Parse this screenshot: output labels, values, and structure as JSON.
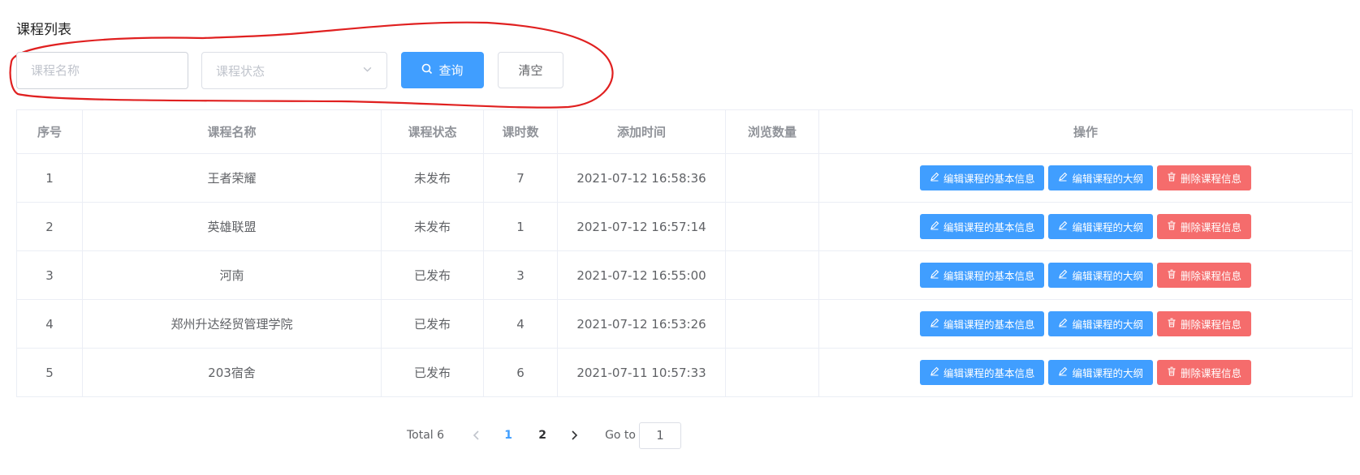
{
  "page": {
    "title": "课程列表"
  },
  "filters": {
    "name_placeholder": "课程名称",
    "status_placeholder": "课程状态",
    "query_label": "查询",
    "clear_label": "清空"
  },
  "colors": {
    "primary": "#409eff",
    "danger": "#f56c6c",
    "annotation": "#e02020"
  },
  "table": {
    "headers": [
      "序号",
      "课程名称",
      "课程状态",
      "课时数",
      "添加时间",
      "浏览数量",
      "操作"
    ],
    "rows": [
      {
        "index": "1",
        "name": "王者荣耀",
        "status": "未发布",
        "hours": "7",
        "time": "2021-07-12 16:58:36",
        "views": ""
      },
      {
        "index": "2",
        "name": "英雄联盟",
        "status": "未发布",
        "hours": "1",
        "time": "2021-07-12 16:57:14",
        "views": ""
      },
      {
        "index": "3",
        "name": "河南",
        "status": "已发布",
        "hours": "3",
        "time": "2021-07-12 16:55:00",
        "views": ""
      },
      {
        "index": "4",
        "name": "郑州升达经贸管理学院",
        "status": "已发布",
        "hours": "4",
        "time": "2021-07-12 16:53:26",
        "views": ""
      },
      {
        "index": "5",
        "name": "203宿舍",
        "status": "已发布",
        "hours": "6",
        "time": "2021-07-11 10:57:33",
        "views": ""
      }
    ],
    "actions": {
      "edit_basic": "编辑课程的基本信息",
      "edit_outline": "编辑课程的大纲",
      "delete": "删除课程信息"
    }
  },
  "pagination": {
    "total_label": "Total 6",
    "pages": [
      "1",
      "2"
    ],
    "current_page": "1",
    "goto_label": "Go to",
    "goto_value": "1"
  }
}
